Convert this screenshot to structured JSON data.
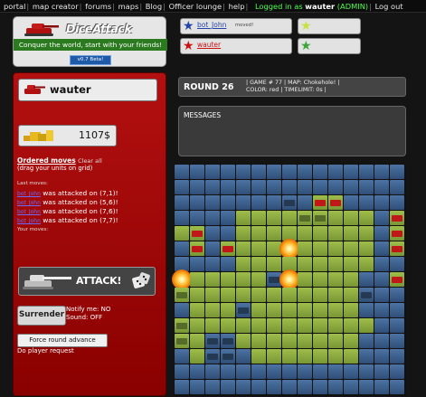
{
  "nav": {
    "items": [
      "portal",
      "map creator",
      "forums",
      "maps",
      "Blog",
      "Officer lounge",
      "help"
    ],
    "login_prefix": "Logged in as",
    "login_user": "wauter",
    "login_role": "(ADMIN)",
    "logout": "Log out"
  },
  "logo": {
    "title_dice": "Dice",
    "title_attack": "Attack",
    "tagline": "Conquer the world, start with your friends!",
    "beta": "v0.7 Beta!"
  },
  "players": [
    {
      "name": "bot_John",
      "status": "moved!",
      "color": "#2244aa"
    },
    {
      "name": "wauter",
      "status": "",
      "color": "#cc1111"
    }
  ],
  "sidebar": {
    "player_name": "wauter",
    "money": "1107$",
    "ordered_moves": "Ordered moves",
    "clear_all": "Clear all",
    "drag_hint": "(drag your units on grid)",
    "last_moves": "Last moves:",
    "attacks": [
      {
        "who": "bot_John",
        "text": "was attacked on (7,1)!"
      },
      {
        "who": "bot_John",
        "text": "was attacked on (5,6)!"
      },
      {
        "who": "bot_John",
        "text": "was attacked on (7,6)!"
      },
      {
        "who": "bot_John",
        "text": "was attacked on (7,7)!"
      }
    ],
    "your_moves": "Your moves:",
    "attack_label": "ATTACK!",
    "surrender": "Surrender",
    "notify": "Notify me: NO",
    "sound": "Sound: OFF",
    "force_round": "Force round advance",
    "do_player_request": "Do player request"
  },
  "round": {
    "label": "ROUND 26",
    "info1": "| GAME # 77 | MAP: Chokehole! |",
    "info2": "COLOR: red | TIMELIMIT: 0s |"
  },
  "messages": {
    "label": "MESSAGES"
  },
  "colors": {
    "water": "#3a5f8a",
    "land": "#8aaa3d",
    "red_team": "#c01818",
    "sidebar": "#a00000"
  }
}
